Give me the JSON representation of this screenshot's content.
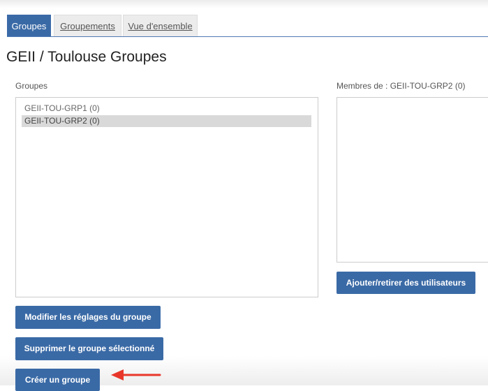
{
  "tabs": [
    {
      "label": "Groupes",
      "active": true
    },
    {
      "label": "Groupements",
      "active": false
    },
    {
      "label": "Vue d'ensemble",
      "active": false
    }
  ],
  "page": {
    "title": "GEII / Toulouse Groupes"
  },
  "groups_panel": {
    "label": "Groupes",
    "options": [
      {
        "label": "GEII-TOU-GRP1 (0)",
        "selected": false
      },
      {
        "label": "GEII-TOU-GRP2 (0)",
        "selected": true
      }
    ]
  },
  "members_panel": {
    "label": "Membres de : GEII-TOU-GRP2 (0)",
    "add_remove_button": "Ajouter/retirer des utilisateurs"
  },
  "actions": {
    "edit_group": "Modifier les réglages du groupe",
    "delete_group": "Supprimer le groupe sélectionné",
    "create_group": "Créer un groupe"
  },
  "colors": {
    "accent": "#3a6aa6",
    "selected_row": "#d9d9d9",
    "annotation_arrow": "#e8372a"
  },
  "annotation": {
    "arrow_icon": "arrow-left-icon"
  }
}
